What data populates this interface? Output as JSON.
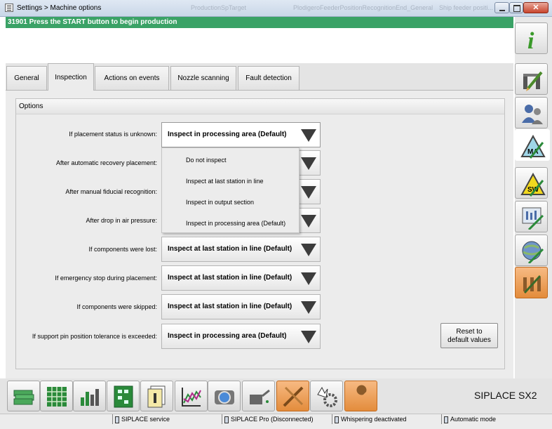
{
  "window": {
    "title": "Settings > Machine options",
    "ghost_texts": [
      "ProductionSpTarget",
      "PlodigeroFeederPositionRecognitionEnd_General",
      "Ship feeder positi..."
    ]
  },
  "status_message": "31901 Press the START button to begin production",
  "tabs": [
    {
      "label": "General",
      "active": false
    },
    {
      "label": "Inspection",
      "active": true
    },
    {
      "label": "Actions on events",
      "active": false
    },
    {
      "label": "Nozzle scanning",
      "active": false
    },
    {
      "label": "Fault detection",
      "active": false
    }
  ],
  "options": {
    "header": "Options",
    "rows": [
      {
        "label": "If placement status is unknown:",
        "value": "Inspect in processing area (Default)"
      },
      {
        "label": "After automatic recovery placement:",
        "value": ""
      },
      {
        "label": "After manual fiducial recognition:",
        "value": ""
      },
      {
        "label": "After drop in air pressure:",
        "value": ""
      },
      {
        "label": "If components were lost:",
        "value": "Inspect at last station in line (Default)"
      },
      {
        "label": "If emergency stop during placement:",
        "value": "Inspect at last station in line (Default)"
      },
      {
        "label": "If components were skipped:",
        "value": "Inspect at last station in line (Default)"
      },
      {
        "label": "If support pin position tolerance is exceeded:",
        "value": "Inspect in processing area (Default)"
      }
    ],
    "dropdown_menu": [
      "Do not inspect",
      "Inspect at last station in line",
      "Inspect in output section",
      "Inspect in processing area (Default)"
    ],
    "reset_button": {
      "line1": "Reset to",
      "line2": "default values"
    }
  },
  "right_sidebar_icons": [
    "info-icon",
    "station-pen-icon",
    "users-icon",
    "ma-warning-icon",
    "sw-warning-icon",
    "panel-pen-icon",
    "globe-pen-icon",
    "machine-options-icon"
  ],
  "bottom_toolbar_icons": [
    "money-stack-icon",
    "grid-icon",
    "bar-graph-icon",
    "board-icon",
    "documents-icon",
    "line-chart-icon",
    "camera-icon",
    "oil-can-icon",
    "tools-icon",
    "hand-gear-icon",
    "wrench-icon"
  ],
  "product": "SIPLACE SX2",
  "footer": [
    "SIPLACE service",
    "SIPLACE Pro (Disconnected)",
    "Whispering deactivated",
    "Automatic mode"
  ],
  "colors": {
    "status_green": "#3aa266",
    "accent_orange": "#e8954a"
  }
}
